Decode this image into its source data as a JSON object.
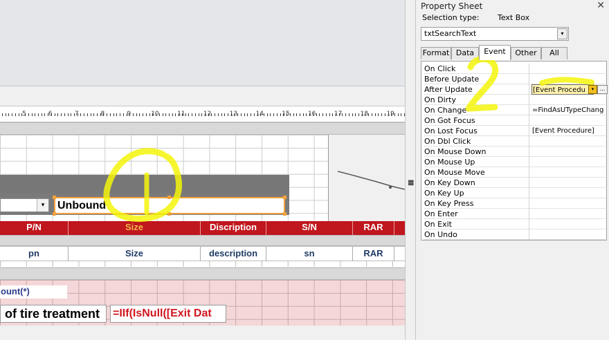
{
  "design": {
    "ruler_numbers": [
      "5",
      "6",
      "7",
      "8",
      "9",
      "10",
      "11",
      "12",
      "13",
      "14",
      "15",
      "16",
      "17",
      "18",
      "19"
    ],
    "combo_arrow": "▾",
    "search_box_text": "Unbound",
    "header_columns": [
      {
        "label": "P/N"
      },
      {
        "label": "Size"
      },
      {
        "label": "Discription"
      },
      {
        "label": "S/N"
      },
      {
        "label": "RAR"
      }
    ],
    "detail_columns": [
      {
        "label": "pn"
      },
      {
        "label": "Size"
      },
      {
        "label": "description"
      },
      {
        "label": "sn"
      },
      {
        "label": "RAR"
      }
    ],
    "count_text": "ount(*)",
    "tire_label": "of tire treatment",
    "iif_text": "=IIf(IsNull([Exit Dat"
  },
  "annotations": {
    "number_1": "1",
    "number_2": "2",
    "color": "#f4f40c"
  },
  "property_sheet": {
    "title": "Property Sheet",
    "close_glyph": "✕",
    "selection_type_label": "Selection type:",
    "selection_type_value": "Text Box",
    "object_name": "txtSearchText",
    "tabs": [
      "Format",
      "Data",
      "Event",
      "Other",
      "All"
    ],
    "active_tab": "Event",
    "rows": [
      {
        "name": "On Click",
        "value": ""
      },
      {
        "name": "Before Update",
        "value": ""
      },
      {
        "name": "After Update",
        "value": "[Event Procedu"
      },
      {
        "name": "On Dirty",
        "value": ""
      },
      {
        "name": "On Change",
        "value": "=FindAsUTypeChang"
      },
      {
        "name": "On Got Focus",
        "value": ""
      },
      {
        "name": "On Lost Focus",
        "value": "[Event Procedure]"
      },
      {
        "name": "On Dbl Click",
        "value": ""
      },
      {
        "name": "On Mouse Down",
        "value": ""
      },
      {
        "name": "On Mouse Up",
        "value": ""
      },
      {
        "name": "On Mouse Move",
        "value": ""
      },
      {
        "name": "On Key Down",
        "value": ""
      },
      {
        "name": "On Key Up",
        "value": ""
      },
      {
        "name": "On Key Press",
        "value": ""
      },
      {
        "name": "On Enter",
        "value": ""
      },
      {
        "name": "On Exit",
        "value": ""
      },
      {
        "name": "On Undo",
        "value": ""
      }
    ],
    "dropdown_glyph": "▾",
    "build_glyph": "..."
  },
  "colors": {
    "header_red": "#c0161d",
    "selected_header_text": "#f2b648",
    "footer_pink": "#f4d7d8",
    "selection_orange": "#f2a13a"
  }
}
